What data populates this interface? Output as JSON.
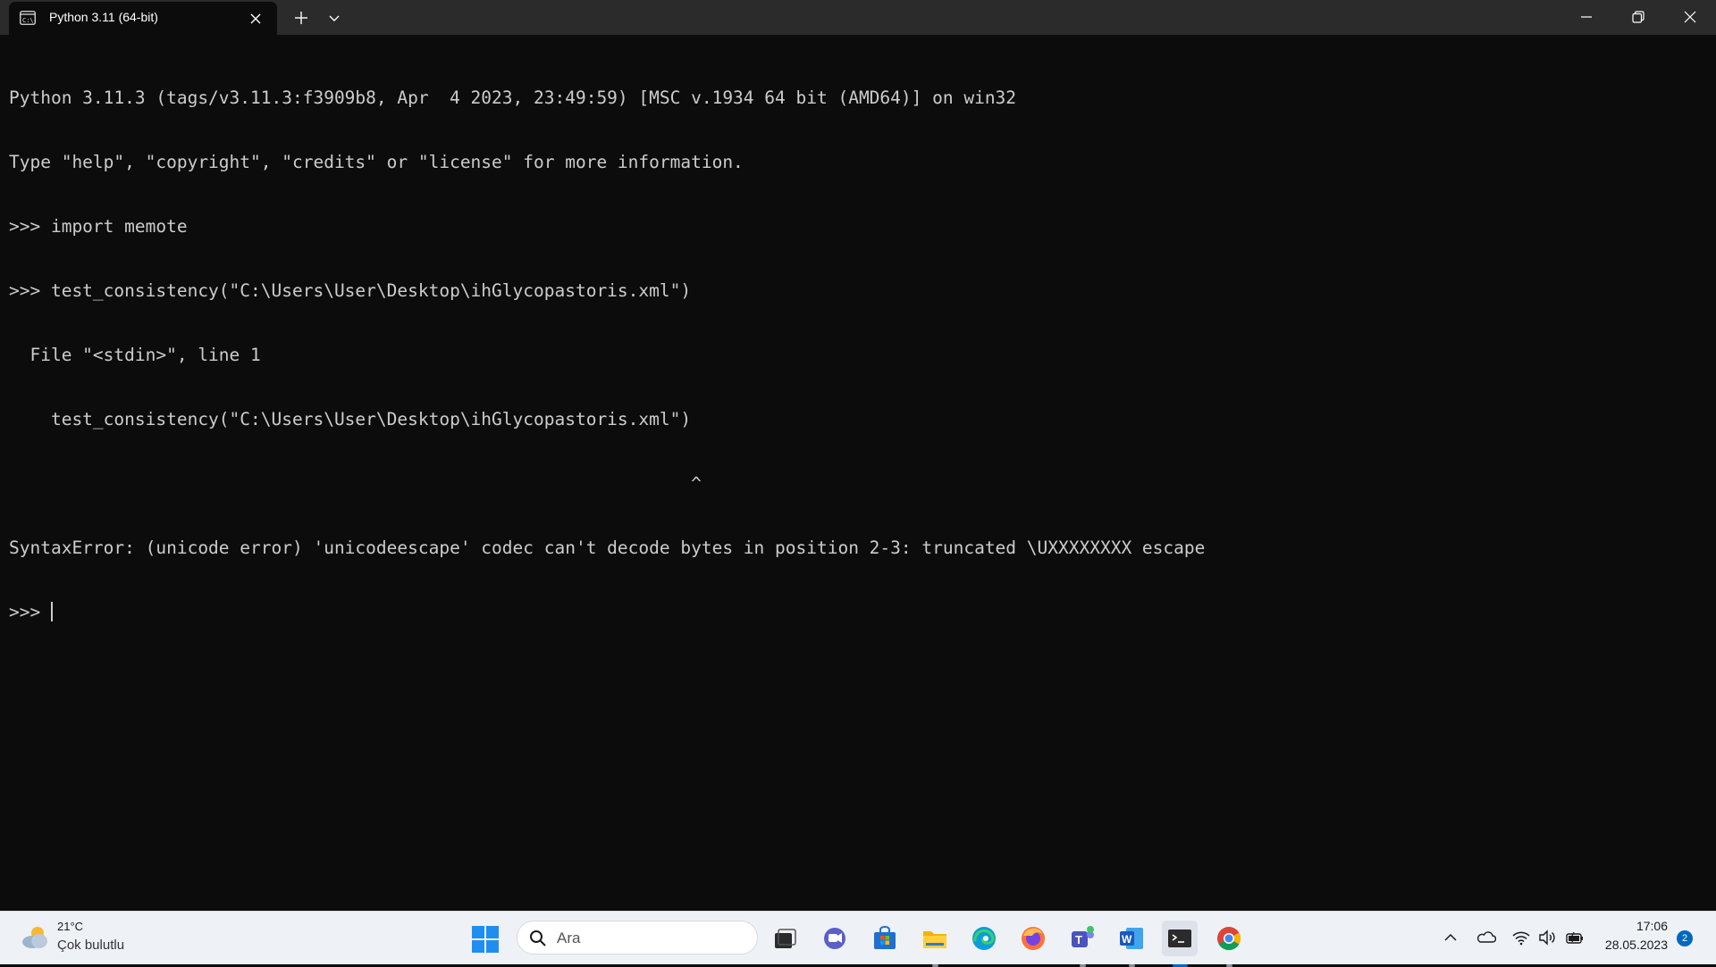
{
  "window": {
    "tab_title": "Python 3.11 (64-bit)"
  },
  "console": {
    "lines": [
      "Python 3.11.3 (tags/v3.11.3:f3909b8, Apr  4 2023, 23:49:59) [MSC v.1934 64 bit (AMD64)] on win32",
      "Type \"help\", \"copyright\", \"credits\" or \"license\" for more information.",
      ">>> import memote",
      ">>> test_consistency(\"C:\\Users\\User\\Desktop\\ihGlycopastoris.xml\")",
      "  File \"<stdin>\", line 1",
      "    test_consistency(\"C:\\Users\\User\\Desktop\\ihGlycopastoris.xml\")",
      "                                                                 ^",
      "SyntaxError: (unicode error) 'unicodeescape' codec can't decode bytes in position 2-3: truncated \\UXXXXXXXX escape"
    ],
    "prompt": ">>> "
  },
  "taskbar": {
    "weather_temp": "21°C",
    "weather_desc": "Çok bulutlu",
    "search_placeholder": "Ara",
    "apps": [
      {
        "name": "task-view-icon"
      },
      {
        "name": "chat-icon"
      },
      {
        "name": "microsoft-store-icon"
      },
      {
        "name": "file-explorer-icon"
      },
      {
        "name": "edge-icon"
      },
      {
        "name": "firefox-icon"
      },
      {
        "name": "teams-icon"
      },
      {
        "name": "word-icon"
      },
      {
        "name": "terminal-icon"
      },
      {
        "name": "chrome-icon"
      }
    ],
    "clock_time": "17:06",
    "clock_date": "28.05.2023",
    "notification_count": "2"
  },
  "colors": {
    "console_bg": "#0c0c0c",
    "console_fg": "#cccccc",
    "titlebar_bg": "#2b2b2b",
    "taskbar_bg": "#eef1f6",
    "accent": "#0067c0"
  }
}
